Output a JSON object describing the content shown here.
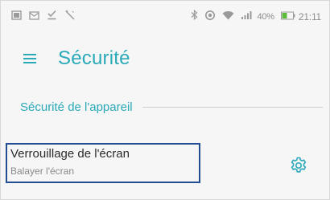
{
  "statusbar": {
    "icons_left": [
      "gallery-icon",
      "mail-icon",
      "download-done-icon",
      "magic-wand-icon"
    ],
    "icons_right": [
      "bluetooth-icon",
      "target-icon",
      "wifi-icon",
      "signal-icon",
      "battery-icon"
    ],
    "battery_pct": "40%",
    "time": "21:11"
  },
  "header": {
    "title": "Sécurité"
  },
  "section": {
    "title": "Sécurité de l'appareil"
  },
  "items": [
    {
      "title": "Verrouillage de l'écran",
      "subtitle": "Balayer l'écran",
      "action_icon": "gear-icon"
    }
  ],
  "colors": {
    "accent": "#2aa9b8",
    "focus": "#1f4f92",
    "text_primary": "#2b2b2b",
    "text_secondary": "#8a8a8a",
    "background": "#f6f6f6"
  }
}
